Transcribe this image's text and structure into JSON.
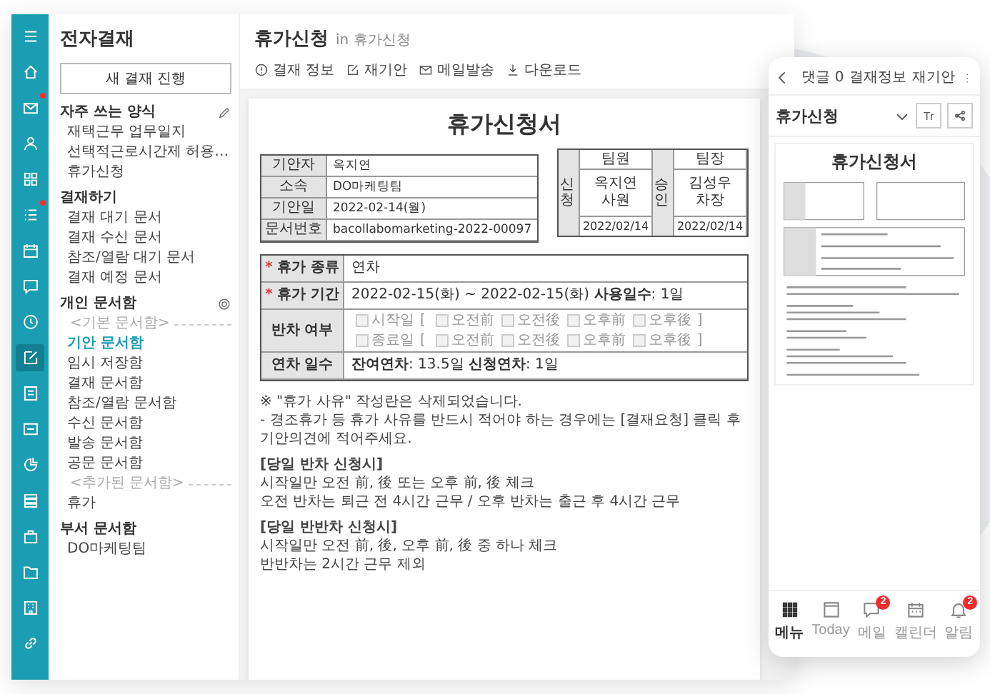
{
  "sidebar_icons": [
    {
      "selected": false,
      "badge": false
    },
    {
      "selected": false,
      "badge": false
    },
    {
      "selected": false,
      "badge": true
    },
    {
      "selected": false,
      "badge": false
    },
    {
      "selected": false,
      "badge": false
    },
    {
      "selected": false,
      "badge": true
    },
    {
      "selected": false,
      "badge": false
    },
    {
      "selected": false,
      "badge": false
    },
    {
      "selected": false,
      "badge": false
    },
    {
      "selected": true,
      "badge": false
    },
    {
      "selected": false,
      "badge": false
    },
    {
      "selected": false,
      "badge": false
    },
    {
      "selected": false,
      "badge": false
    },
    {
      "selected": false,
      "badge": false
    },
    {
      "selected": false,
      "badge": false
    },
    {
      "selected": false,
      "badge": false
    },
    {
      "selected": false,
      "badge": false
    },
    {
      "selected": false,
      "badge": false
    }
  ],
  "sidebar": {
    "title": "전자결재",
    "new_button": "새 결재 진행",
    "sections": [
      {
        "title": "자주 쓰는 양식",
        "kind": "editable",
        "items": [
          {
            "kind": "item",
            "label": "재택근무 업무일지",
            "selected": false
          },
          {
            "kind": "item",
            "label": "선택적근로시간제 허용…",
            "selected": false
          },
          {
            "kind": "item",
            "label": "휴가신청",
            "selected": false
          }
        ]
      },
      {
        "title": "결재하기",
        "kind": "plain",
        "items": [
          {
            "kind": "item",
            "label": "결재 대기 문서",
            "selected": false
          },
          {
            "kind": "item",
            "label": "결재 수신 문서",
            "selected": false
          },
          {
            "kind": "item",
            "label": "참조/열람 대기 문서",
            "selected": false
          },
          {
            "kind": "item",
            "label": "결재 예정 문서",
            "selected": false
          }
        ]
      },
      {
        "title": "개인 문서함",
        "kind": "configurable",
        "items": [
          {
            "kind": "group",
            "label": "<기본 문서함>"
          },
          {
            "kind": "item",
            "label": "기안 문서함",
            "selected": true
          },
          {
            "kind": "item",
            "label": "임시 저장함",
            "selected": false
          },
          {
            "kind": "item",
            "label": "결재 문서함",
            "selected": false
          },
          {
            "kind": "item",
            "label": "참조/열람 문서함",
            "selected": false
          },
          {
            "kind": "item",
            "label": "수신 문서함",
            "selected": false
          },
          {
            "kind": "item",
            "label": "발송 문서함",
            "selected": false
          },
          {
            "kind": "item",
            "label": "공문 문서함",
            "selected": false
          },
          {
            "kind": "group",
            "label": "<추가된 문서함>"
          },
          {
            "kind": "item",
            "label": "휴가",
            "selected": false
          }
        ]
      },
      {
        "title": "부서 문서함",
        "kind": "plain",
        "items": [
          {
            "kind": "item",
            "label": "DO마케팅팀",
            "selected": false
          }
        ]
      }
    ]
  },
  "header": {
    "title": "휴가신청",
    "subtitle": "in 휴가신청"
  },
  "toolbar": [
    {
      "label": "결재 정보"
    },
    {
      "label": "재기안"
    },
    {
      "label": "메일발송"
    },
    {
      "label": "다운로드"
    }
  ],
  "document": {
    "title": "휴가신청서",
    "info": [
      {
        "label": "기안자",
        "value": "옥지연"
      },
      {
        "label": "소속",
        "value": "DO마케팅팀"
      },
      {
        "label": "기안일",
        "value": "2022-02-14(월)"
      },
      {
        "label": "문서번호",
        "value": "bacollabomarketing-2022-00097"
      }
    ],
    "approvals": [
      {
        "side": "신청",
        "role": "팀원",
        "name": "옥지연",
        "position": "사원",
        "date": "2022/02/14"
      },
      {
        "side": "승인",
        "role": "팀장",
        "name": "김성우",
        "position": "차장",
        "date": "2022/02/14"
      }
    ],
    "fields": [
      {
        "kind": "text",
        "label": "휴가 종류",
        "marker": "*",
        "value": "연차"
      },
      {
        "kind": "text",
        "label": "휴가 기간",
        "marker": "*",
        "value": "2022-02-15(화) ~ 2022-02-15(화) **사용일수**: 1일"
      },
      {
        "kind": "checks",
        "label": "반차 여부",
        "rows": [
          {
            "label": "시작일",
            "checked": false,
            "disabled": true,
            "open": "[",
            "close": "]",
            "options": [
              {
                "label": "오전前",
                "checked": false
              },
              {
                "label": "오전後",
                "checked": false
              },
              {
                "label": "오후前",
                "checked": false
              },
              {
                "label": "오후後",
                "checked": false
              }
            ]
          },
          {
            "label": "종료일",
            "checked": false,
            "disabled": true,
            "open": "[",
            "close": "]",
            "options": [
              {
                "label": "오전前",
                "checked": false
              },
              {
                "label": "오전後",
                "checked": false
              },
              {
                "label": "오후前",
                "checked": false
              },
              {
                "label": "오후後",
                "checked": false
              }
            ]
          }
        ]
      },
      {
        "kind": "text",
        "label": "연차 일수",
        "value": "**잔여연차**: 13.5일  **신청연차**: 1일"
      }
    ],
    "notes": [
      {
        "kind": "plain",
        "text": "※ \"휴가 사유\" 작성란은 삭제되었습니다."
      },
      {
        "kind": "plain",
        "text": "- 경조휴가 등 휴가 사유를 반드시 적어야 하는 경우에는 [결재요청] 클릭 후 기안의견에 적어주세요."
      },
      {
        "kind": "heading",
        "text": "[당일 반차 신청시]"
      },
      {
        "kind": "plain",
        "text": "시작일만 오전 前, 後 또는 오후 前, 後 체크"
      },
      {
        "kind": "plain",
        "text": "오전 반차는 퇴근 전 4시간 근무 / 오후 반차는 출근 후 4시간 근무"
      },
      {
        "kind": "heading",
        "text": "[당일 반반차 신청시]"
      },
      {
        "kind": "plain",
        "text": "시작일만 오전 前, 後, 오후 前, 後 중 하나 체크"
      },
      {
        "kind": "plain",
        "text": "반반차는 2시간 근무 제외"
      }
    ]
  },
  "mobile": {
    "actions": [
      "댓글 0",
      "결재정보",
      "재기안"
    ],
    "title": "휴가신청",
    "text_size": "Tr",
    "doc_title": "휴가신청서",
    "nav": [
      {
        "label": "메뉴",
        "selected": true
      },
      {
        "label": "Today",
        "selected": false
      },
      {
        "label": "메일",
        "selected": false,
        "badge": "2"
      },
      {
        "label": "캘린더",
        "selected": false
      },
      {
        "label": "알림",
        "selected": false,
        "badge": "2"
      }
    ]
  }
}
